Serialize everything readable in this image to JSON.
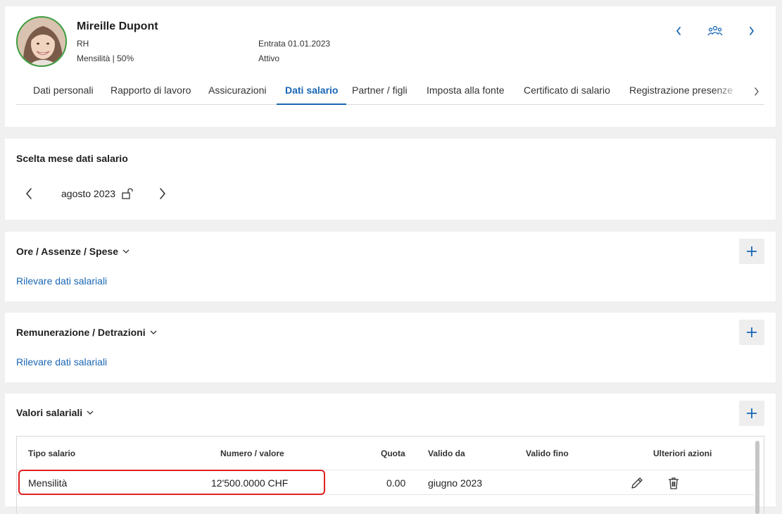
{
  "employee": {
    "name": "Mireille Dupont",
    "department": "RH",
    "contract": "Mensilità | 50%",
    "entry": "Entrata 01.01.2023",
    "status": "Attivo"
  },
  "tabs": [
    {
      "label": "Dati personali"
    },
    {
      "label": "Rapporto di lavoro"
    },
    {
      "label": "Assicurazioni"
    },
    {
      "label": "Dati salario"
    },
    {
      "label": "Partner / figli"
    },
    {
      "label": "Imposta alla fonte"
    },
    {
      "label": "Certificato di salario"
    },
    {
      "label": "Registrazione presenze"
    }
  ],
  "month_section": {
    "title": "Scelta mese dati salario",
    "month": "agosto 2023"
  },
  "ore_section": {
    "title": "Ore / Assenze / Spese",
    "link": "Rilevare dati salariali"
  },
  "rem_section": {
    "title": "Remunerazione / Detrazioni",
    "link": "Rilevare dati salariali"
  },
  "values_section": {
    "title": "Valori salariali",
    "columns": {
      "type": "Tipo salario",
      "value": "Numero / valore",
      "quota": "Quota",
      "from": "Valido da",
      "to": "Valido fino",
      "actions": "Ulteriori azioni"
    },
    "rows": [
      {
        "type": "Mensilità",
        "value": "12'500.0000 CHF",
        "quota": "0.00",
        "from": "giugno 2023",
        "to": ""
      }
    ]
  },
  "colors": {
    "accent": "#1a66b3",
    "highlight": "#e02020",
    "avatar_ring": "#3c9c3c"
  },
  "icons": [
    "chevron-left-icon",
    "team-icon",
    "chevron-right-icon",
    "unlock-icon",
    "chevron-down-icon",
    "plus-icon",
    "pencil-icon",
    "trash-icon"
  ]
}
